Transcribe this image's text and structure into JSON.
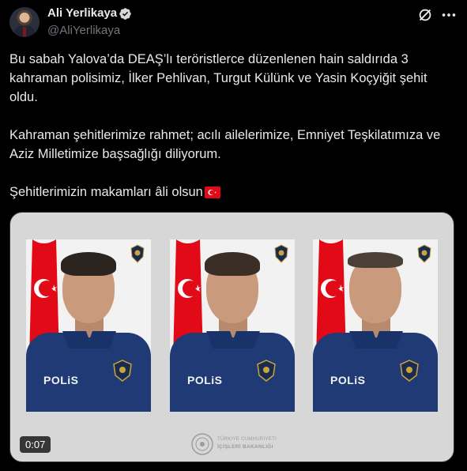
{
  "author": {
    "display_name": "Ali Yerlikaya",
    "handle": "@AliYerlikaya",
    "verified": true
  },
  "icons": {
    "verified": "verified-badge-icon",
    "grok": "grok-icon",
    "more": "more-options-icon",
    "flag": "turkey-flag-emoji"
  },
  "tweet": {
    "paragraphs": [
      "Bu sabah Yalova’da DEAŞ’lı teröristlerce düzenlenen hain saldırıda 3 kahraman polisimiz, İlker Pehlivan, Turgut Külünk ve Yasin Koçyiğit şehit oldu.",
      "Kahraman şehitlerimize rahmet; acılı ailelerimize, Emniyet Teşkilatımıza ve Aziz Milletimize başsağlığı diliyorum.",
      "Şehitlerimizin makamları âli olsun"
    ]
  },
  "media": {
    "type": "video",
    "duration": "0:07",
    "portraits": [
      {
        "uniform_text": "POLiS"
      },
      {
        "uniform_text": "POLiS"
      },
      {
        "uniform_text": "POLiS"
      }
    ],
    "ministry": {
      "line1": "TÜRKİYE CUMHURİYETİ",
      "line2": "İÇİŞLERİ BAKANLIĞI"
    }
  },
  "colors": {
    "background": "#000000",
    "text": "#e7e9ea",
    "secondary_text": "#71767b",
    "verified": "#1d9bf0",
    "flag_red": "#e30a17",
    "uniform_navy": "#1f3a75"
  }
}
